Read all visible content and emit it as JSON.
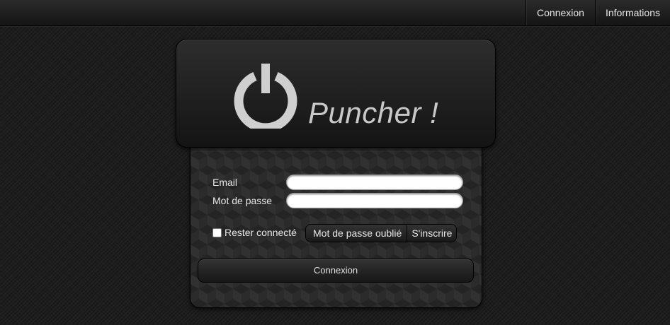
{
  "nav": {
    "items": [
      {
        "label": "Connexion"
      },
      {
        "label": "Informations"
      }
    ]
  },
  "header": {
    "icon": "power-icon",
    "title": "Puncher !"
  },
  "form": {
    "email_label": "Email",
    "email_value": "",
    "password_label": "Mot de passe",
    "password_value": "",
    "remember_label": "Rester connecté",
    "remember_checked": false,
    "forgot_label": "Mot de passe oublié",
    "signup_label": "S'inscrire",
    "submit_label": "Connexion"
  },
  "colors": {
    "background": "#1e1e1e",
    "title": "#c8c8c8",
    "icon": "#cfcfcf"
  }
}
